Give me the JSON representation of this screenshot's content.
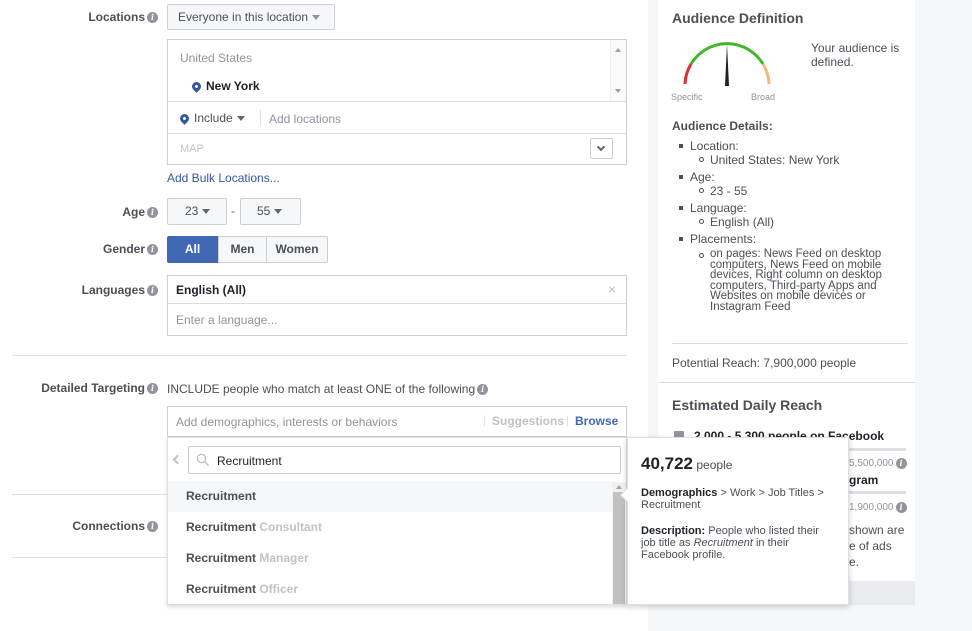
{
  "locations": {
    "label": "Locations",
    "dropdown": "Everyone in this location",
    "country": "United States",
    "city": "New York",
    "include": "Include",
    "add_placeholder": "Add locations",
    "map": "MAP",
    "bulk_link": "Add Bulk Locations..."
  },
  "age": {
    "label": "Age",
    "min": "23",
    "max": "55",
    "separator": "-"
  },
  "gender": {
    "label": "Gender",
    "options": [
      "All",
      "Men",
      "Women"
    ],
    "selected": "All"
  },
  "languages": {
    "label": "Languages",
    "value": "English (All)",
    "clear": "×",
    "placeholder": "Enter a language..."
  },
  "detailed": {
    "label": "Detailed Targeting",
    "include_text": "INCLUDE people who match at least ONE of the following",
    "placeholder": "Add demographics, interests or behaviors",
    "suggestions": "Suggestions",
    "separator": "|",
    "browse": "Browse",
    "search_value": "Recruitment",
    "results": [
      {
        "bold": "Recruitment",
        "muted": ""
      },
      {
        "bold": "Recruitment",
        "muted": " Consultant"
      },
      {
        "bold": "Recruitment",
        "muted": " Manager"
      },
      {
        "bold": "Recruitment",
        "muted": " Officer"
      }
    ]
  },
  "connections": {
    "label": "Connections"
  },
  "tooltip": {
    "count": "40,722",
    "unit": "people",
    "category_label": "Demographics",
    "path": " > Work > Job Titles > Recruitment",
    "desc_label": "Description:",
    "desc_pre": " People who listed their job title as ",
    "desc_em": "Recruitment",
    "desc_post": " in their Facebook profile."
  },
  "audience": {
    "title": "Audience Definition",
    "status": "Your audience is defined.",
    "specific": "Specific",
    "broad": "Broad",
    "details_title": "Audience Details:",
    "details": [
      {
        "label": "Location:",
        "sub": "United States: New York"
      },
      {
        "label": "Age:",
        "sub": "23 - 55"
      },
      {
        "label": "Language:",
        "sub": "English (All)"
      },
      {
        "label": "Placements:",
        "sub": "on pages: News Feed on desktop computers, News Feed on mobile devices, Right column on desktop computers, Third-party Apps and Websites on mobile devices or Instagram Feed"
      }
    ],
    "potential_reach": "Potential Reach: 7,900,000 people"
  },
  "daily_reach": {
    "title": "Estimated Daily Reach",
    "facebook": "2,000 - 5,300 people on Facebook",
    "fb_max": "5,500,000",
    "instagram_partial": "gram",
    "ig_max": "1,900,000",
    "note_lines": [
      "shown are",
      "e of ads",
      "e."
    ]
  },
  "colors": {
    "accent": "#4267b2",
    "link": "#365899",
    "gauge_green": "#42b72a",
    "gauge_red": "#e02d2d",
    "gauge_orange": "#f5b977"
  },
  "icons": [
    "info-icon",
    "location-pin-icon",
    "search-icon",
    "chevron-left-icon",
    "chevron-down-icon",
    "caret-down-icon",
    "gauge-icon",
    "facebook-icon"
  ]
}
